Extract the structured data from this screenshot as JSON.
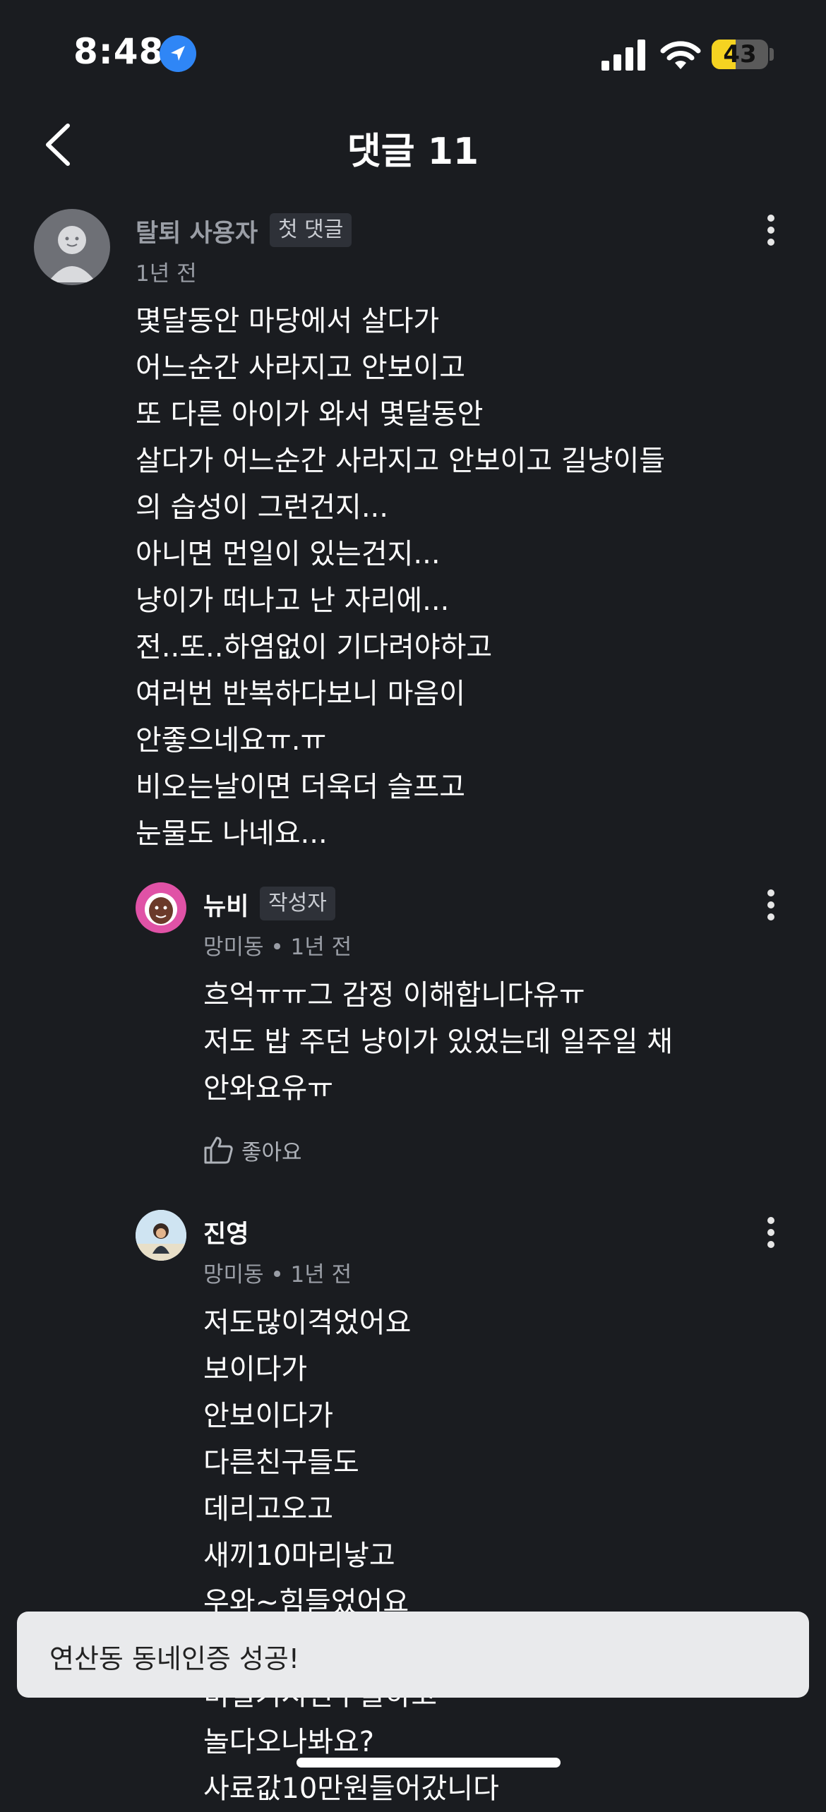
{
  "status_bar": {
    "time": "8:48",
    "battery": "43",
    "battery_level": 0.43
  },
  "header": {
    "title": "댓글 11"
  },
  "comments": [
    {
      "author": "탈퇴 사용자",
      "badge": "첫 댓글",
      "meta": "1년 전",
      "text": "몇달동안 마당에서 살다가\n어느순간 사라지고 안보이고\n또 다른 아이가 와서 몇달동안\n살다가 어느순간 사라지고 안보이고 길냥이들\n의 습성이 그런건지...\n아니면 먼일이 있는건지...\n냥이가 떠나고 난 자리에...\n전..또..하염없이 기다려야하고\n여러번 반복하다보니 마음이\n안좋으네요ㅠ.ㅠ\n비오는날이면 더욱더 슬프고\n눈물도 나네요..."
    },
    {
      "author": "뉴비",
      "badge": "작성자",
      "meta": "망미동 • 1년 전",
      "text": "흐억ㅠㅠ그 감정 이해합니다유ㅠ\n저도 밥 주던 냥이가 있었는데 일주일 채\n안와요유ㅠ",
      "like_label": "좋아요"
    },
    {
      "author": "진영",
      "meta": "망미동 • 1년 전",
      "text": "저도많이격었어요\n보이다가\n안보이다가\n다른친구들도\n데리고오고\n새끼10마리낳고\n우와~힘들었어요\n친구들이들도\n미실기시친구들하고\n놀다오나봐요?\n사료값10만원들어갔니다"
    }
  ],
  "toast": {
    "message": "연산동 동네인증 성공!"
  }
}
